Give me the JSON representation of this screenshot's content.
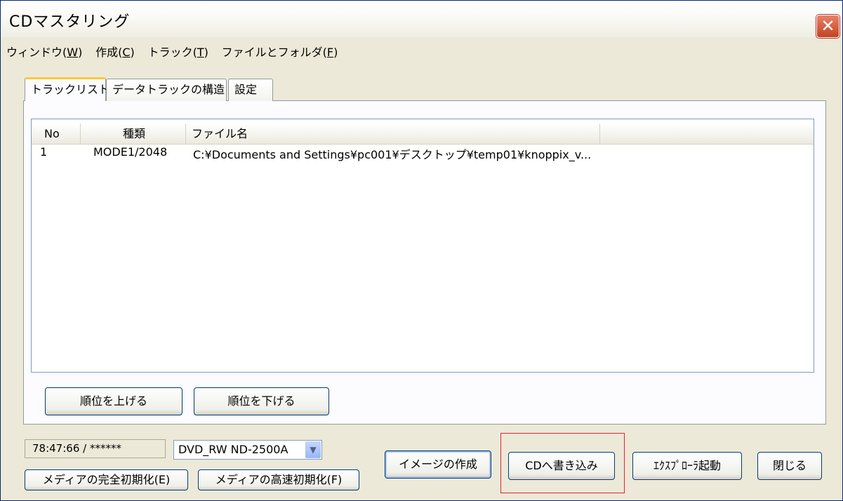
{
  "window": {
    "title": "CDマスタリング"
  },
  "menu": [
    {
      "label": "ウィンドウ(",
      "key": "W",
      "end": ")"
    },
    {
      "label": "作成(",
      "key": "C",
      "end": ")"
    },
    {
      "label": "トラック(",
      "key": "T",
      "end": ")"
    },
    {
      "label": "ファイルとフォルダ(",
      "key": "F",
      "end": ")"
    }
  ],
  "tabs": [
    "トラックリスト",
    "データトラックの構造",
    "設定"
  ],
  "tracklist": {
    "columns": [
      "No",
      "種類",
      "ファイル名"
    ],
    "rows": [
      {
        "no": "1",
        "type": "MODE1/2048",
        "file": "C:¥Documents and Settings¥pc001¥デスクトップ¥temp01¥knoppix_v..."
      }
    ]
  },
  "buttons": {
    "move_up": "順位を上げる",
    "move_down": "順位を下げる",
    "full_erase": "メディアの完全初期化(E)",
    "quick_erase": "メディアの高速初期化(F)",
    "create_image": "イメージの作成",
    "write_cd": "CDへ書き込み",
    "open_explorer": "ｴｸｽﾌﾟﾛｰﾗ起動",
    "close": "閉じる"
  },
  "status": {
    "time": "78:47:66 / ******"
  },
  "drive": {
    "selected": "DVD_RW ND-2500A"
  },
  "colors": {
    "highlight": "#e8202a",
    "title_close": "#c4421f"
  }
}
